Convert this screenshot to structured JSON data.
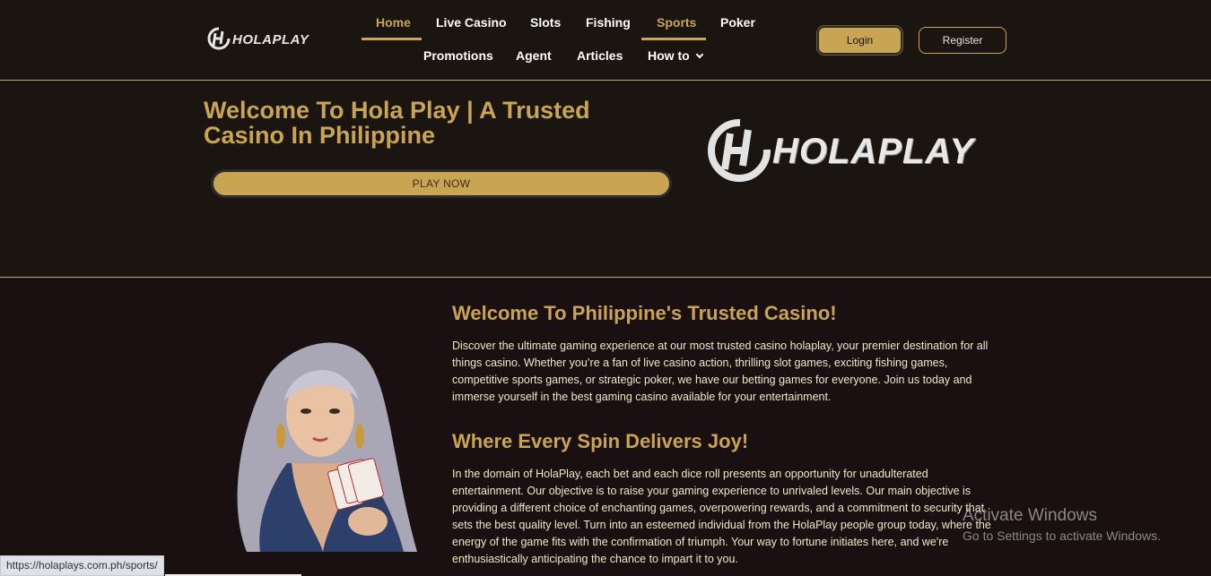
{
  "brand": {
    "name": "HOLAPLAY"
  },
  "nav": {
    "row1": [
      {
        "label": "Home",
        "active": true
      },
      {
        "label": "Live Casino",
        "active": false
      },
      {
        "label": "Slots",
        "active": false
      },
      {
        "label": "Fishing",
        "active": false
      },
      {
        "label": "Sports",
        "active": true
      },
      {
        "label": "Poker",
        "active": false
      }
    ],
    "row2": [
      {
        "label": "Promotions"
      },
      {
        "label": "Agent"
      },
      {
        "label": "Articles"
      },
      {
        "label": "How to",
        "icon": "chevron-down-icon"
      }
    ]
  },
  "auth": {
    "login_label": "Login",
    "register_label": "Register"
  },
  "hero": {
    "title": "Welcome To Hola Play | A Trusted Casino In Philippine",
    "play_label": "PLAY NOW"
  },
  "content": {
    "section1": {
      "heading": "Welcome To Philippine's Trusted Casino!",
      "body": "Discover the ultimate gaming experience at our most trusted casino holaplay, your premier destination for all things casino. Whether you’re a fan of live casino action, thrilling slot games, exciting fishing games, competitive sports games, or strategic poker, we have our betting games for everyone. Join us today and immerse yourself in the best gaming casino available for your entertainment."
    },
    "section2": {
      "heading": "Where Every Spin Delivers Joy!",
      "body": "In the domain of HolaPlay, each bet and each dice roll presents an opportunity for unadulterated entertainment. Our objective is to raise your gaming experience to unrivaled levels. Our main objective is providing a different choice of enchanting games, overpowering rewards, and a commitment to security that sets the best quality level. Turn into an esteemed individual from the HolaPlay people group today, where the energy of the game fits with the confirmation of triumph. Your way to fortune initiates here, and we're enthusiastically anticipating the chance to impart it to you."
    }
  },
  "status_bar": {
    "url": "https://holaplays.com.ph/sports/"
  },
  "watermark": {
    "line1": "Activate Windows",
    "line2": "Go to Settings to activate Windows."
  },
  "colors": {
    "accent": "#c9a553",
    "background": "#1b1512",
    "content_bg": "#1a1011"
  }
}
